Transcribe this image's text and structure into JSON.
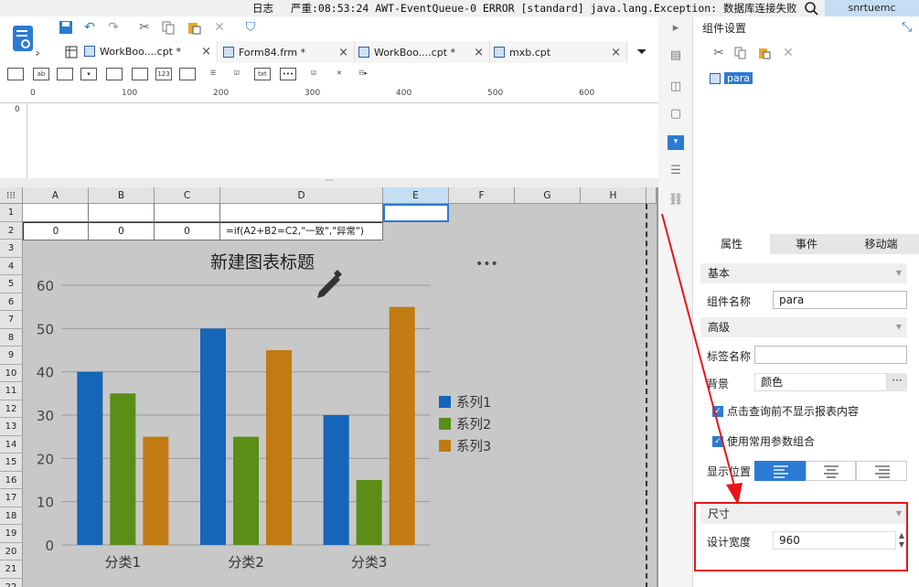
{
  "statusbar": {
    "log_label": "日志",
    "message": "严重:08:53:24 AWT-EventQueue-0 ERROR [standard] java.lang.Exception: 数据库连接失败",
    "user": "snrtuemc"
  },
  "tabs": [
    {
      "label": "WorkBoo....cpt *",
      "active": true
    },
    {
      "label": "Form84.frm *",
      "active": false
    },
    {
      "label": "WorkBoo....cpt *",
      "active": false
    },
    {
      "label": "mxb.cpt",
      "active": false
    }
  ],
  "toolbar2_labels": [
    "",
    "ab",
    "",
    "",
    "",
    "123",
    "",
    "",
    "",
    "txt",
    "",
    "",
    ""
  ],
  "ruler": {
    "marks": [
      "0",
      "100",
      "200",
      "300",
      "400",
      "500",
      "600"
    ],
    "vmark": "0"
  },
  "grid": {
    "columns": [
      "A",
      "B",
      "C",
      "D",
      "E",
      "F",
      "G",
      "H"
    ],
    "rows": [
      "1",
      "2",
      "3",
      "4",
      "5",
      "6",
      "7",
      "8",
      "9",
      "10",
      "11",
      "12",
      "13",
      "14",
      "15",
      "16",
      "17",
      "18",
      "19",
      "20",
      "21",
      "22"
    ],
    "row2": {
      "A": "0",
      "B": "0",
      "C": "0",
      "D": "=if(A2+B2=C2,\"一致\",\"异常\")"
    }
  },
  "chart_data": {
    "type": "bar",
    "title": "新建图表标题",
    "categories": [
      "分类1",
      "分类2",
      "分类3"
    ],
    "series": [
      {
        "name": "系列1",
        "values": [
          40,
          50,
          30
        ],
        "color": "#1565b8"
      },
      {
        "name": "系列2",
        "values": [
          35,
          25,
          15
        ],
        "color": "#5a8e17"
      },
      {
        "name": "系列3",
        "values": [
          25,
          45,
          55
        ],
        "color": "#c27a12"
      }
    ],
    "ylim": [
      0,
      60
    ],
    "yticks": [
      "0",
      "10",
      "20",
      "30",
      "40",
      "50",
      "60"
    ],
    "grid": true,
    "legend_position": "right"
  },
  "panel": {
    "title": "组件设置",
    "tree_item": "para",
    "tabs": [
      "属性",
      "事件",
      "移动端"
    ],
    "basic": "基本",
    "name_label": "组件名称",
    "name_value": "para",
    "advanced": "高级",
    "tag_label": "标签名称",
    "tag_value": "",
    "bg_label": "背景",
    "bg_value": "颜色",
    "check1": "点击查询前不显示报表内容",
    "check2": "使用常用参数组合",
    "align_label": "显示位置",
    "size": "尺寸",
    "width_label": "设计宽度",
    "width_value": "960"
  },
  "colors": {
    "accent": "#2b7bd4",
    "highlight": "#e8141b"
  }
}
